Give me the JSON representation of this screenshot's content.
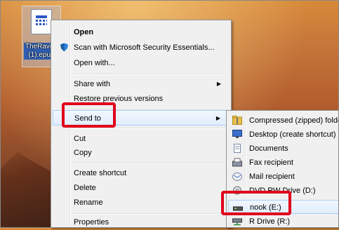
{
  "desktop": {
    "file_icon": "epub-file-icon",
    "file_label": "TheRaven (1).epub"
  },
  "context_menu": {
    "items": [
      {
        "label": "Open",
        "bold": true
      },
      {
        "label": "Scan with Microsoft Security Essentials...",
        "icon": "shield-icon"
      },
      {
        "label": "Open with..."
      },
      {
        "label": "Share with",
        "submenu": true
      },
      {
        "label": "Restore previous versions"
      },
      {
        "label": "Send to",
        "submenu": true,
        "highlighted": true
      },
      {
        "label": "Cut"
      },
      {
        "label": "Copy"
      },
      {
        "label": "Create shortcut"
      },
      {
        "label": "Delete"
      },
      {
        "label": "Rename"
      },
      {
        "label": "Properties"
      }
    ],
    "submenu_arrow": "▶"
  },
  "send_to_menu": {
    "items": [
      {
        "label": "Compressed (zipped) folder",
        "icon": "zip-folder-icon"
      },
      {
        "label": "Desktop (create shortcut)",
        "icon": "desktop-icon"
      },
      {
        "label": "Documents",
        "icon": "documents-icon"
      },
      {
        "label": "Fax recipient",
        "icon": "fax-icon"
      },
      {
        "label": "Mail recipient",
        "icon": "mail-icon"
      },
      {
        "label": "DVD RW Drive (D:)",
        "icon": "dvd-drive-icon"
      },
      {
        "label": "nook (E:)",
        "icon": "removable-drive-icon",
        "highlighted": true
      },
      {
        "label": "R Drive (R:)",
        "icon": "network-drive-icon"
      }
    ]
  },
  "colors": {
    "annotation_red": "#e0001b",
    "menu_bg": "#f0f0f0",
    "highlight": "#e1edfd"
  }
}
